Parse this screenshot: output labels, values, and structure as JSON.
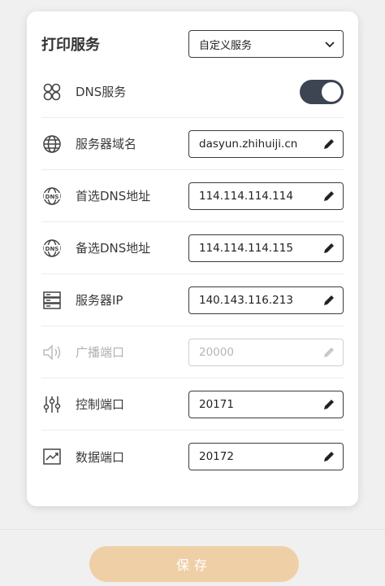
{
  "header": {
    "title": "打印服务",
    "service_select": {
      "value": "自定义服务"
    }
  },
  "rows": [
    {
      "label": "DNS服务",
      "type": "toggle",
      "enabled": true,
      "icon": "clover-icon"
    },
    {
      "label": "服务器域名",
      "value": "dasyun.zhihuiji.cn",
      "icon": "globe-icon"
    },
    {
      "label": "首选DNS地址",
      "value": "114.114.114.114",
      "icon": "dns-globe-icon"
    },
    {
      "label": "备选DNS地址",
      "value": "114.114.114.115",
      "icon": "dns-globe-icon"
    },
    {
      "label": "服务器IP",
      "value": "140.143.116.213",
      "icon": "server-icon"
    },
    {
      "label": "广播端口",
      "value": "20000",
      "disabled": true,
      "icon": "speaker-icon"
    },
    {
      "label": "控制端口",
      "value": "20171",
      "icon": "sliders-icon"
    },
    {
      "label": "数据端口",
      "value": "20172",
      "icon": "chart-icon"
    }
  ],
  "footer": {
    "save_label": "保存"
  },
  "colors": {
    "toggle_on": "#3d4452",
    "save_button": "#efcfa6",
    "border": "#3c3c3c"
  }
}
